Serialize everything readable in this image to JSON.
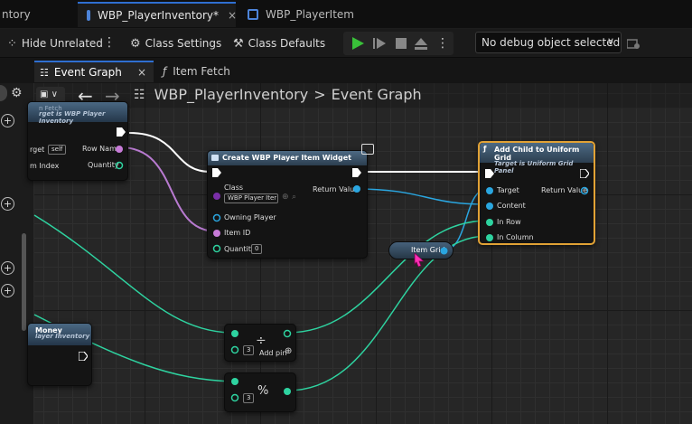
{
  "tabs": [
    {
      "label": "ntory"
    },
    {
      "label": "WBP_PlayerInventory*",
      "close": "×"
    },
    {
      "label": "WBP_PlayerItem"
    }
  ],
  "toolbar": {
    "hide_unrelated": "Hide Unrelated",
    "class_settings": "Class Settings",
    "class_defaults": "Class Defaults",
    "debug_object": "No debug object selected"
  },
  "doc_tabs": {
    "event_graph": "Event Graph",
    "event_graph_close": "×",
    "item_fetch": "Item Fetch"
  },
  "breadcrumb": {
    "blueprint": "WBP_PlayerInventory",
    "separator": ">",
    "graph": "Event Graph"
  },
  "nodes": {
    "fetch": {
      "title": "n Fetch",
      "subtitle": "rget is WBP Player Inventory",
      "target_label": "rget",
      "target_value": "self",
      "row_name": "Row Name",
      "item_index": "m Index",
      "quantity": "Quantity"
    },
    "create_widget": {
      "title": "Create WBP Player Item Widget",
      "class_label": "Class",
      "class_value": "WBP Player Iter",
      "return_value": "Return Value",
      "owning_player": "Owning Player",
      "item_id": "Item ID",
      "quantity": "Quantity",
      "quantity_value": "0"
    },
    "add_child": {
      "title": "Add Child to Uniform Grid",
      "subtitle": "Target is Uniform Grid Panel",
      "target": "Target",
      "return_value": "Return Value",
      "content": "Content",
      "in_row": "In Row",
      "in_column": "In Column"
    },
    "item_grid": {
      "label": "Item Grid"
    },
    "money": {
      "title": "Money",
      "subtitle": "layer Inventory"
    },
    "divide": {
      "op": "÷",
      "value": "3",
      "add_pin": "Add pin"
    },
    "modulo": {
      "op": "%",
      "value": "3"
    }
  },
  "colors": {
    "exec": "#ffffff",
    "object": "#2aa6e0",
    "name": "#c77bd8",
    "int": "#2ed3a0",
    "accent": "#e1a235"
  }
}
